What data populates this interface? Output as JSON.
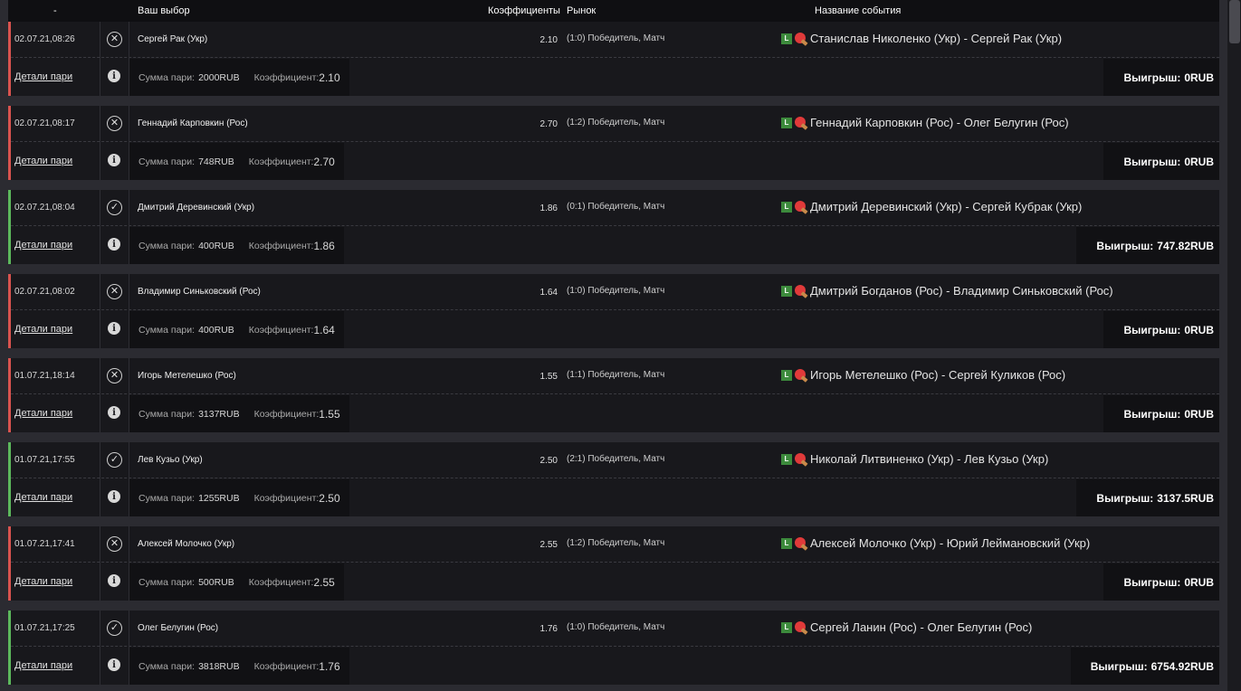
{
  "header": {
    "col_dash": "-",
    "col_choice": "Ваш выбор",
    "col_coef": "Коэффициенты",
    "col_market": "Рынок",
    "col_event": "Название события"
  },
  "labels": {
    "details": "Детали пари",
    "stake": "Сумма пари:",
    "coef": "Коэффициент:",
    "win": "Выигрыш:",
    "live": "L"
  },
  "colors": {
    "lost": "#d9534f",
    "won": "#5cb85c"
  },
  "bets": [
    {
      "date": "02.07.21,08:26",
      "status": "lost",
      "choice": "Сергей Рак (Укр)",
      "coef": "2.10",
      "market": "(1:0) Победитель, Матч",
      "event": "Станислав Николенко (Укр) - Сергей Рак (Укр)",
      "stake": "2000RUB",
      "coef_detail": "2.10",
      "win": "0RUB"
    },
    {
      "date": "02.07.21,08:17",
      "status": "lost",
      "choice": "Геннадий Карповкин (Рос)",
      "coef": "2.70",
      "market": "(1:2) Победитель, Матч",
      "event": "Геннадий Карповкин (Рос) - Олег Белугин (Рос)",
      "stake": "748RUB",
      "coef_detail": "2.70",
      "win": "0RUB"
    },
    {
      "date": "02.07.21,08:04",
      "status": "won",
      "choice": "Дмитрий Деревинский (Укр)",
      "coef": "1.86",
      "market": "(0:1) Победитель, Матч",
      "event": "Дмитрий Деревинский (Укр) - Сергей Кубрак (Укр)",
      "stake": "400RUB",
      "coef_detail": "1.86",
      "win": "747.82RUB"
    },
    {
      "date": "02.07.21,08:02",
      "status": "lost",
      "choice": "Владимир Синьковский (Рос)",
      "coef": "1.64",
      "market": "(1:0) Победитель, Матч",
      "event": "Дмитрий Богданов (Рос) - Владимир Синьковский (Рос)",
      "stake": "400RUB",
      "coef_detail": "1.64",
      "win": "0RUB"
    },
    {
      "date": "01.07.21,18:14",
      "status": "lost",
      "choice": "Игорь Метелешко (Рос)",
      "coef": "1.55",
      "market": "(1:1) Победитель, Матч",
      "event": "Игорь Метелешко (Рос) - Сергей Куликов (Рос)",
      "stake": "3137RUB",
      "coef_detail": "1.55",
      "win": "0RUB"
    },
    {
      "date": "01.07.21,17:55",
      "status": "won",
      "choice": "Лев Кузьо (Укр)",
      "coef": "2.50",
      "market": "(2:1) Победитель, Матч",
      "event": "Николай Литвиненко (Укр) - Лев Кузьо (Укр)",
      "stake": "1255RUB",
      "coef_detail": "2.50",
      "win": "3137.5RUB"
    },
    {
      "date": "01.07.21,17:41",
      "status": "lost",
      "choice": "Алексей Молочко (Укр)",
      "coef": "2.55",
      "market": "(1:2) Победитель, Матч",
      "event": "Алексей Молочко (Укр) - Юрий Леймановский (Укр)",
      "stake": "500RUB",
      "coef_detail": "2.55",
      "win": "0RUB"
    },
    {
      "date": "01.07.21,17:25",
      "status": "won",
      "choice": "Олег Белугин (Рос)",
      "coef": "1.76",
      "market": "(1:0) Победитель, Матч",
      "event": "Сергей Ланин (Рос) - Олег Белугин (Рос)",
      "stake": "3818RUB",
      "coef_detail": "1.76",
      "win": "6754.92RUB"
    }
  ]
}
